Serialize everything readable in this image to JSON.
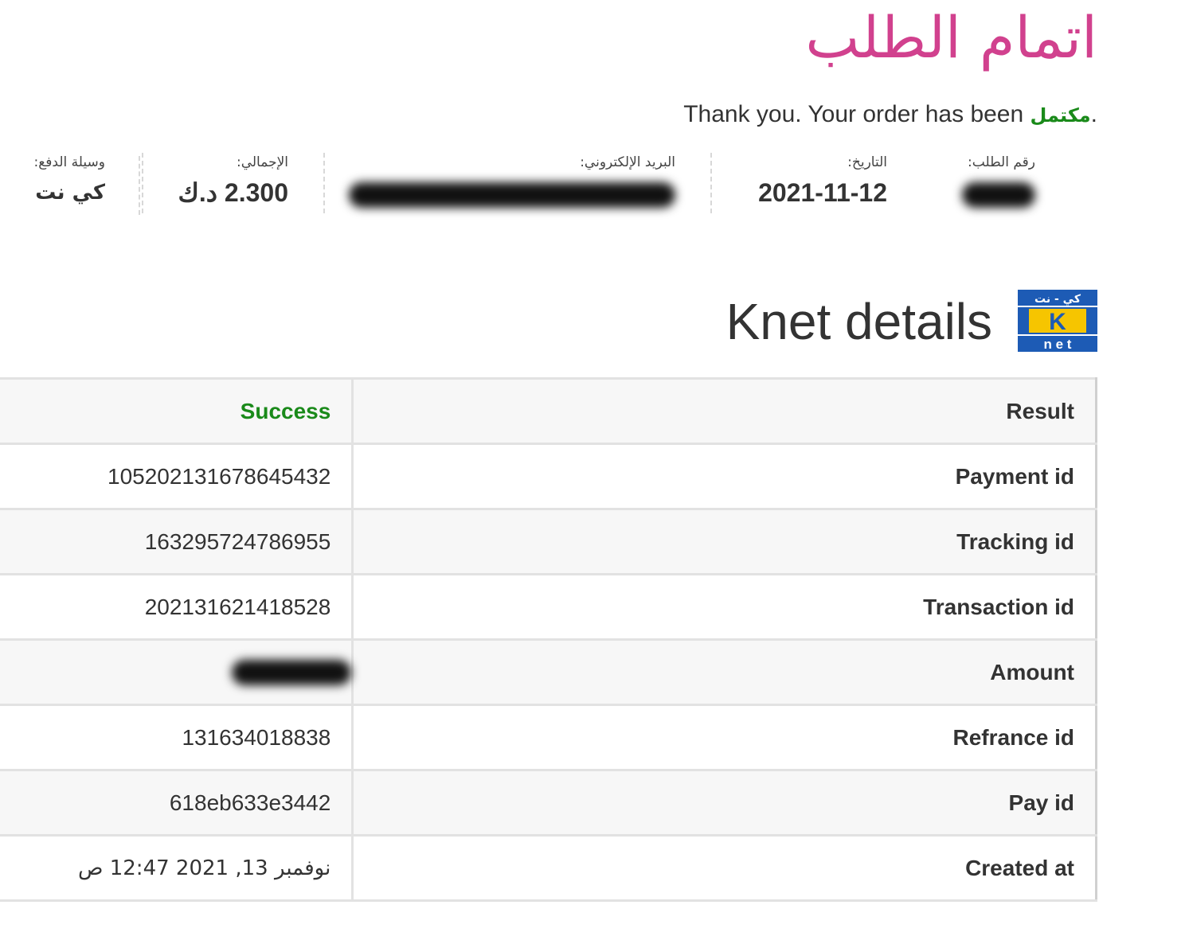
{
  "page": {
    "title": "اتمام الطلب",
    "thank_you_text": "Thank you. Your order has been",
    "status_word": "مكتمل",
    "status_period": "."
  },
  "overview": {
    "order_number": {
      "label": "رقم الطلب:",
      "value": "",
      "redacted": true
    },
    "date": {
      "label": "التاريخ:",
      "value": "2021-11-12"
    },
    "email": {
      "label": "البريد الإلكتروني:",
      "value": "",
      "redacted": true
    },
    "total": {
      "label": "الإجمالي:",
      "value": "2.300 د.ك"
    },
    "payment_method": {
      "label": "وسيلة الدفع:",
      "value": "كي نت"
    }
  },
  "knet": {
    "heading": "Knet details",
    "logo": {
      "name": "knet-logo-icon",
      "arabic_text": "كي - نت",
      "letter": "K",
      "latin_text": "n e t",
      "colors": {
        "blue": "#1d5bb5",
        "yellow": "#f6c500",
        "white": "#ffffff"
      }
    },
    "rows": [
      {
        "label": "Result",
        "value": "Success"
      },
      {
        "label": "Payment id",
        "value": "105202131678645432"
      },
      {
        "label": "Tracking id",
        "value": "163295724786955"
      },
      {
        "label": "Transaction id",
        "value": "202131621418528"
      },
      {
        "label": "Amount",
        "value": "",
        "redacted": true
      },
      {
        "label": "Refrance id",
        "value": "131634018838"
      },
      {
        "label": "Pay id",
        "value": "618eb633e3442"
      },
      {
        "label": "Created at",
        "value": "نوفمبر 13, 2021 12:47 ص"
      }
    ]
  },
  "colors": {
    "title": "#d1418e",
    "success": "#1a8a1a",
    "text": "#333333",
    "row_alt": "#f7f7f7",
    "border": "#e2e2e2"
  }
}
